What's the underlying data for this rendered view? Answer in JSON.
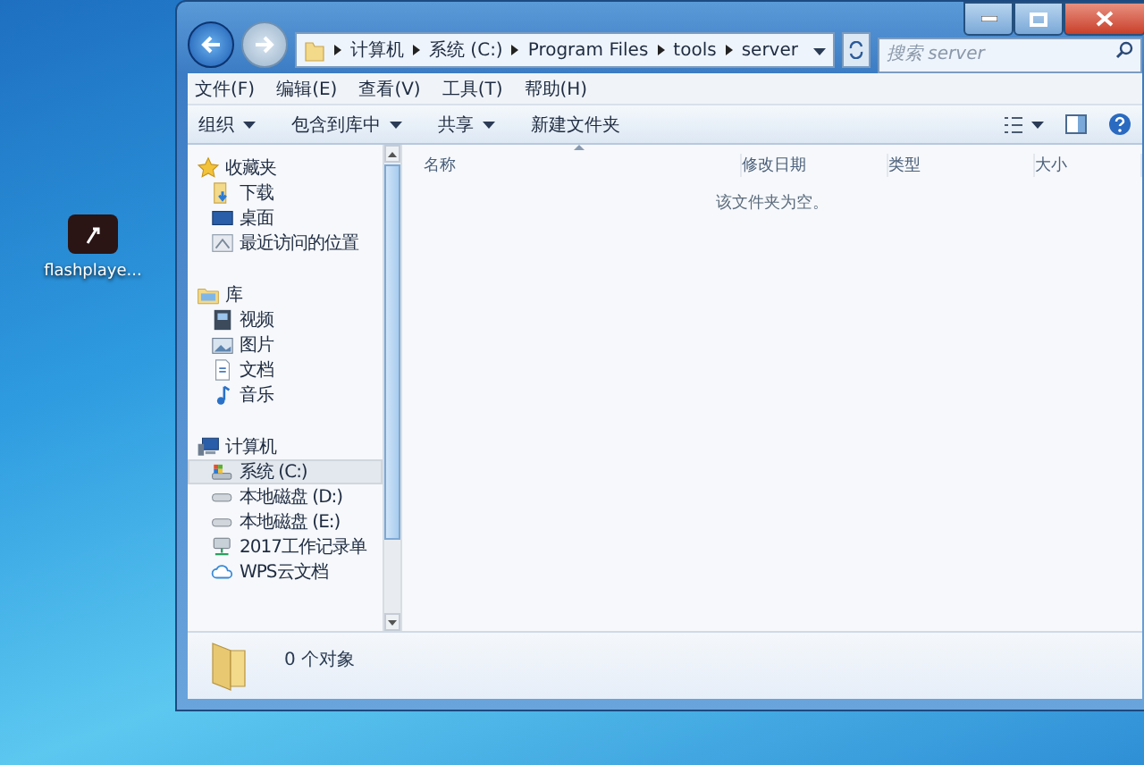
{
  "desktop_icons": [
    {
      "label": "flashplaye..."
    }
  ],
  "address_bar": {
    "path": [
      "计算机",
      "系统 (C:)",
      "Program Files",
      "tools",
      "server"
    ]
  },
  "search": {
    "placeholder": "搜索 server"
  },
  "menu": [
    "文件(F)",
    "编辑(E)",
    "查看(V)",
    "工具(T)",
    "帮助(H)"
  ],
  "toolbar": [
    {
      "label": "组织",
      "dropdown": true
    },
    {
      "label": "包含到库中",
      "dropdown": true
    },
    {
      "label": "共享",
      "dropdown": true
    },
    {
      "label": "新建文件夹",
      "dropdown": false
    }
  ],
  "nav_pane": {
    "groups": [
      {
        "label": "收藏夹",
        "kind": "star",
        "selected": false,
        "children": [
          {
            "label": "下载",
            "kind": "download",
            "selected": false
          },
          {
            "label": "桌面",
            "kind": "desktop",
            "selected": false
          },
          {
            "label": "最近访问的位置",
            "kind": "recent",
            "selected": false
          }
        ]
      },
      {
        "label": "库",
        "kind": "library",
        "selected": false,
        "children": [
          {
            "label": "视频",
            "kind": "video",
            "selected": false
          },
          {
            "label": "图片",
            "kind": "picture",
            "selected": false
          },
          {
            "label": "文档",
            "kind": "document",
            "selected": false
          },
          {
            "label": "音乐",
            "kind": "music",
            "selected": false
          }
        ]
      },
      {
        "label": "计算机",
        "kind": "computer",
        "selected": false,
        "children": [
          {
            "label": "系统 (C:)",
            "kind": "system-drive",
            "selected": true
          },
          {
            "label": "本地磁盘 (D:)",
            "kind": "drive",
            "selected": false
          },
          {
            "label": "本地磁盘 (E:)",
            "kind": "drive",
            "selected": false
          },
          {
            "label": "2017工作记录单",
            "kind": "network-drive",
            "selected": false
          },
          {
            "label": "WPS云文档",
            "kind": "cloud",
            "selected": false
          }
        ]
      }
    ]
  },
  "columns": [
    "名称",
    "修改日期",
    "类型",
    "大小"
  ],
  "empty_message": "该文件夹为空。",
  "details_pane": {
    "count": "0 个对象"
  }
}
